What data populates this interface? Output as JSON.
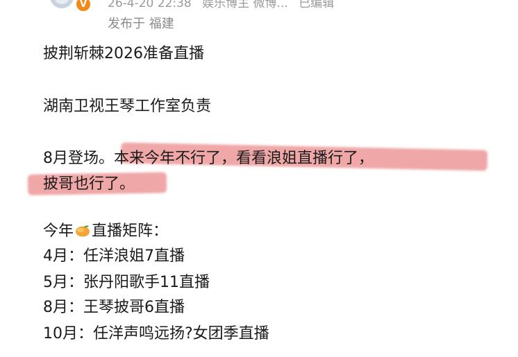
{
  "author": {
    "meta": [
      "26-4-20 22:38",
      "娱乐博主 微博...",
      "已编辑"
    ],
    "location": "发布于 福建"
  },
  "post": {
    "line1": "披荆斩棘2026准备直播",
    "line2": "湖南卫视王琴工作室负责",
    "line3a": "8月登场。",
    "line3b": "本来今年不行了，看看浪姐直播行了，",
    "line4": "披哥也行了。",
    "matrix_prefix": "今年",
    "matrix_suffix": "直播矩阵：",
    "schedule": [
      {
        "month": "4月：",
        "text": "任洋浪姐7直播"
      },
      {
        "month": "5月：",
        "text": "张丹阳歌手11直播"
      },
      {
        "month": "8月：",
        "text": "王琴披哥6直播"
      },
      {
        "month": "10月：",
        "text": "任洋声鸣远扬?女团季直播"
      }
    ]
  },
  "colors": {
    "highlight": "#e25f5f",
    "badge": "#f08a1a",
    "meta_text": "#9a9a9a"
  },
  "icons": [
    "verified-badge-icon",
    "mango-icon"
  ]
}
